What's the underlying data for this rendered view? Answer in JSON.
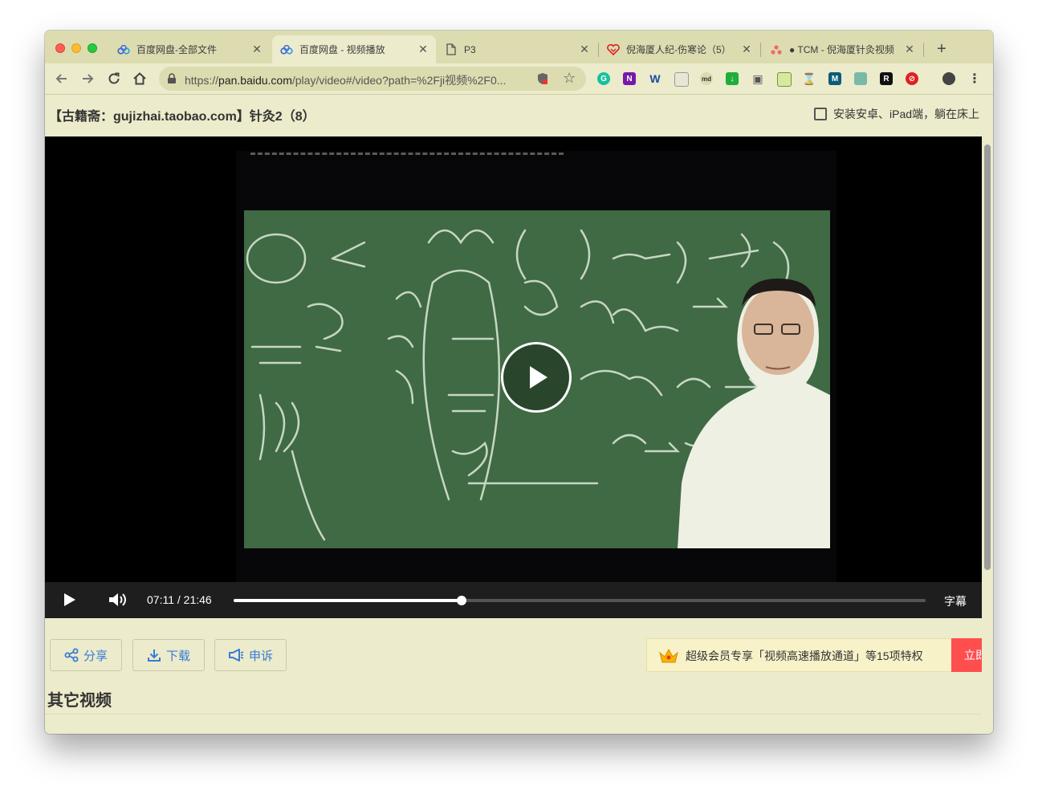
{
  "browser": {
    "tabs": [
      {
        "title": "百度网盘-全部文件",
        "favicon": "baidu-netdisk-icon",
        "active": false
      },
      {
        "title": "百度网盘 - 视频播放",
        "favicon": "baidu-netdisk-icon",
        "active": true
      },
      {
        "title": "P3",
        "favicon": "document-icon",
        "active": false
      },
      {
        "title": "倪海厦人纪-伤寒论（5）",
        "favicon": "heart-logo-icon",
        "active": false
      },
      {
        "title": "● TCM - 倪海厦针灸视频",
        "favicon": "asana-icon",
        "active": false
      }
    ],
    "new_tab_label": "+",
    "close_label": "✕",
    "url_scheme": "https://",
    "url_host": "pan.baidu.com",
    "url_path": "/play/video#/video?path=%2Fji视频%2F0...",
    "extensions": [
      "grammarly-icon",
      "onenote-icon",
      "word-icon",
      "notes-icon",
      "markdown-icon",
      "download-icon",
      "camera-icon",
      "tile-icon",
      "hourglass-icon",
      "m-icon",
      "book-icon",
      "r-icon",
      "block-icon",
      "profile-icon",
      "menu-icon"
    ]
  },
  "page": {
    "title": "【古籍斋：gujizhai.taobao.com】针灸2（8）",
    "install_text": "安装安卓、iPad端，躺在床上"
  },
  "player": {
    "current_time": "07:11",
    "separator": "/",
    "duration": "21:46",
    "progress": 0.329,
    "subtitle_label": "字幕"
  },
  "actions": {
    "share": "分享",
    "download": "下载",
    "report": "申诉"
  },
  "promo": {
    "text": "超级会员专享「视频高速播放通道」等15项特权",
    "cta": "立即开通"
  },
  "other_videos_title": "其它视频",
  "colors": {
    "page_bg": "#ecebcb",
    "tabstrip_bg": "#dcdcb0",
    "link_blue": "#3a7bd5",
    "cta_red": "#ff4e4e"
  }
}
